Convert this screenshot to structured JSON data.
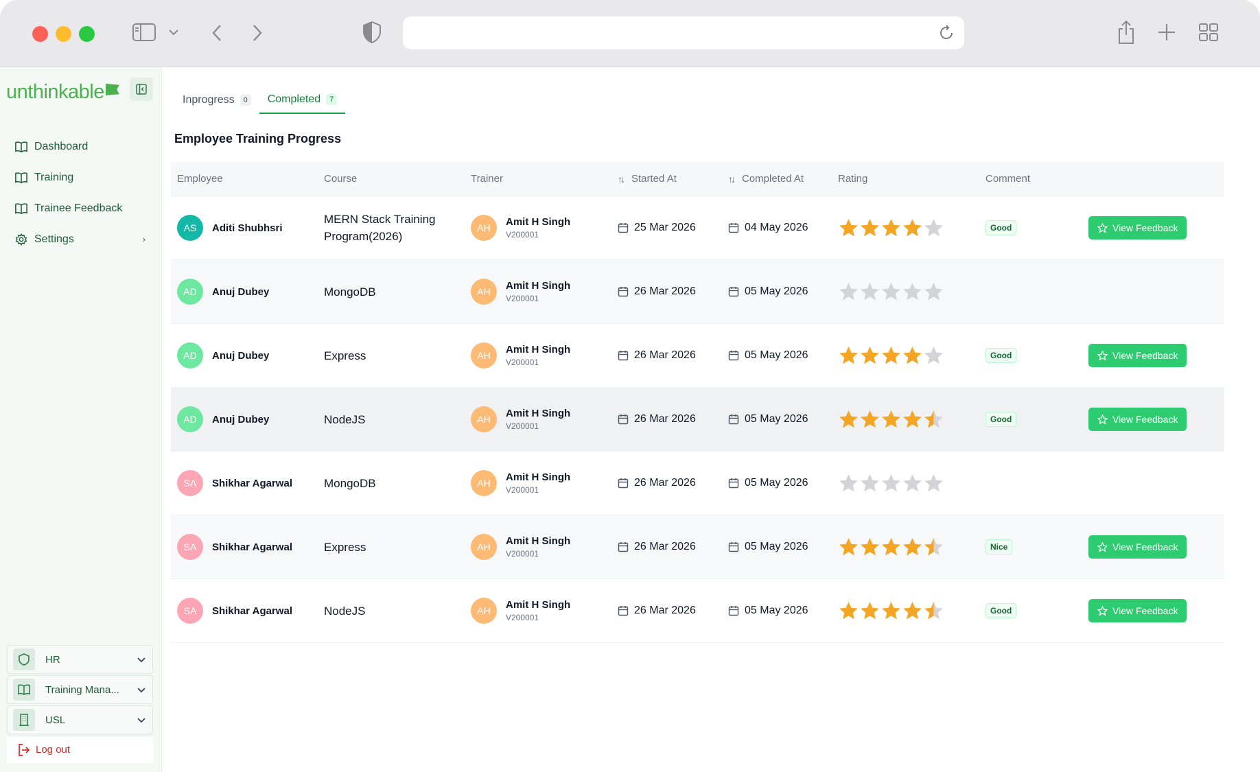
{
  "sidebar": {
    "logo": "unthinkable",
    "nav": [
      {
        "label": "Dashboard",
        "icon": "book-open-icon"
      },
      {
        "label": "Training",
        "icon": "book-open-icon"
      },
      {
        "label": "Trainee Feedback",
        "icon": "book-open-icon"
      },
      {
        "label": "Settings",
        "icon": "gear-icon"
      }
    ],
    "modules": [
      {
        "label": "HR",
        "icon": "shield-icon"
      },
      {
        "label": "Training Mana...",
        "icon": "book-open-icon"
      },
      {
        "label": "USL",
        "icon": "building-icon"
      }
    ],
    "logout": "Log out"
  },
  "tabs": [
    {
      "label": "Inprogress",
      "count": "0"
    },
    {
      "label": "Completed",
      "count": "7"
    }
  ],
  "section_title": "Employee Training Progress",
  "table": {
    "headers": {
      "employee": "Employee",
      "course": "Course",
      "trainer": "Trainer",
      "started": "Started At",
      "completed": "Completed At",
      "rating": "Rating",
      "comment": "Comment"
    },
    "action_label": "View Feedback",
    "rows": [
      {
        "initials": "AS",
        "employee": "Aditi Shubhsri",
        "course": "MERN Stack Training Program(2026)",
        "trainer_initials": "AH",
        "trainer": "Amit H Singh",
        "trainer_id": "V200001",
        "started": "25 Mar 2026",
        "completed": "04 May 2026",
        "rating": 4,
        "comment": "Good",
        "has_feedback": true
      },
      {
        "initials": "AD",
        "employee": "Anuj Dubey",
        "course": "MongoDB",
        "trainer_initials": "AH",
        "trainer": "Amit H Singh",
        "trainer_id": "V200001",
        "started": "26 Mar 2026",
        "completed": "05 May 2026",
        "rating": 0,
        "comment": "",
        "has_feedback": false
      },
      {
        "initials": "AD",
        "employee": "Anuj Dubey",
        "course": "Express",
        "trainer_initials": "AH",
        "trainer": "Amit H Singh",
        "trainer_id": "V200001",
        "started": "26 Mar 2026",
        "completed": "05 May 2026",
        "rating": 4,
        "comment": "Good",
        "has_feedback": true
      },
      {
        "initials": "AD",
        "employee": "Anuj Dubey",
        "course": "NodeJS",
        "trainer_initials": "AH",
        "trainer": "Amit H Singh",
        "trainer_id": "V200001",
        "started": "26 Mar 2026",
        "completed": "05 May 2026",
        "rating": 4.5,
        "comment": "Good",
        "has_feedback": true
      },
      {
        "initials": "SA",
        "employee": "Shikhar Agarwal",
        "course": "MongoDB",
        "trainer_initials": "AH",
        "trainer": "Amit H Singh",
        "trainer_id": "V200001",
        "started": "26 Mar 2026",
        "completed": "05 May 2026",
        "rating": 0,
        "comment": "",
        "has_feedback": false
      },
      {
        "initials": "SA",
        "employee": "Shikhar Agarwal",
        "course": "Express",
        "trainer_initials": "AH",
        "trainer": "Amit H Singh",
        "trainer_id": "V200001",
        "started": "26 Mar 2026",
        "completed": "05 May 2026",
        "rating": 4.5,
        "comment": "Nice",
        "has_feedback": true
      },
      {
        "initials": "SA",
        "employee": "Shikhar Agarwal",
        "course": "NodeJS",
        "trainer_initials": "AH",
        "trainer": "Amit H Singh",
        "trainer_id": "V200001",
        "started": "26 Mar 2026",
        "completed": "05 May 2026",
        "rating": 4.5,
        "comment": "Good",
        "has_feedback": true
      }
    ]
  },
  "colors": {
    "brand": "#4caf50",
    "star_filled": "#f5a524",
    "star_empty": "#d4d4d8",
    "button": "#2ecc71",
    "avatar_AS": "#14b8a6",
    "avatar_AD": "#6ee7a0",
    "avatar_SA": "#fca5b4",
    "avatar_AH": "#fdba74"
  }
}
